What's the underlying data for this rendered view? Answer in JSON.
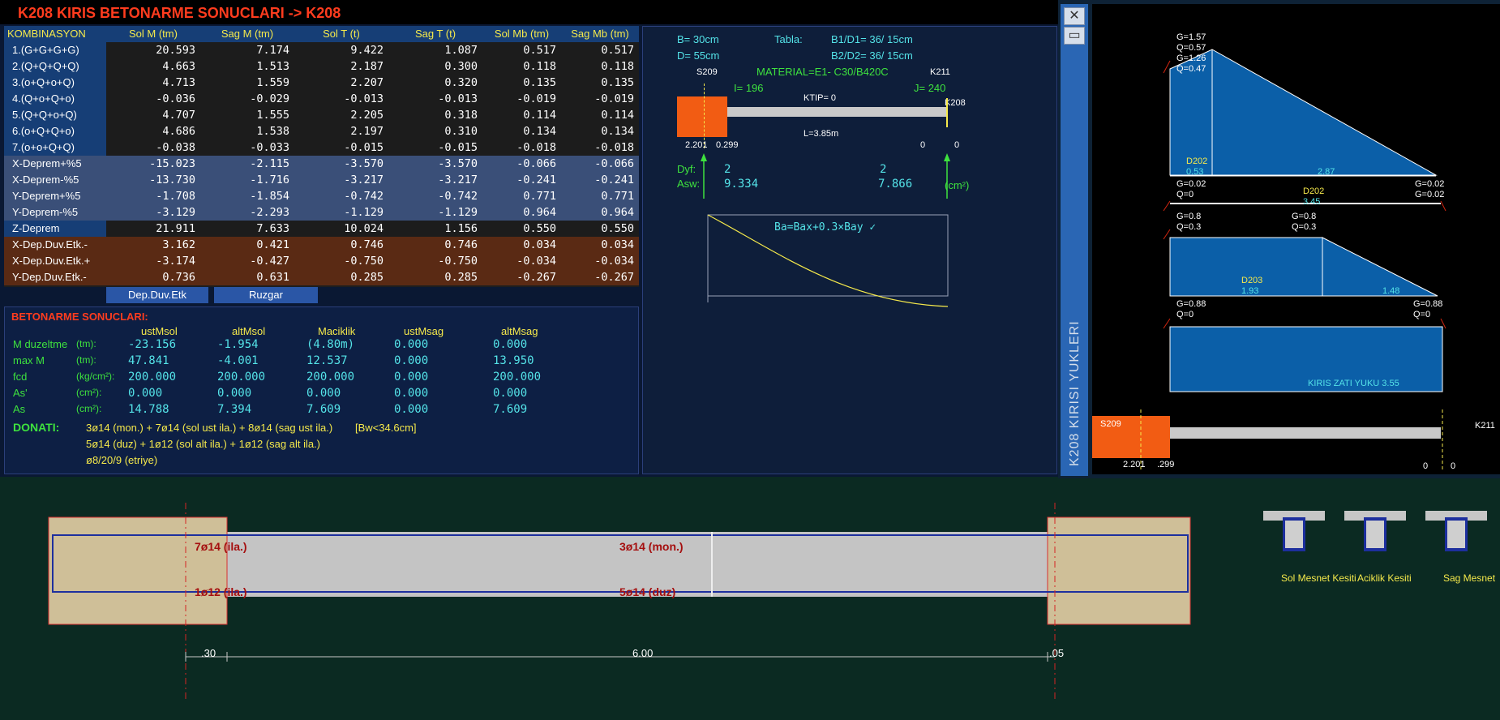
{
  "title": "K208 KIRIS BETONARME SONUCLARI  ->  K208",
  "table": {
    "headers": [
      "KOMBINASYON",
      "Sol M (tm)",
      "Sag M (tm)",
      "Sol T (t)",
      "Sag T (t)",
      "Sol Mb (tm)",
      "Sag Mb (tm)"
    ],
    "rows": [
      {
        "label": "1.(G+G+G+G)",
        "values": [
          "20.593",
          "7.174",
          "9.422",
          "1.087",
          "0.517",
          "0.517"
        ]
      },
      {
        "label": "2.(Q+Q+Q+Q)",
        "values": [
          "4.663",
          "1.513",
          "2.187",
          "0.300",
          "0.118",
          "0.118"
        ]
      },
      {
        "label": "3.(o+Q+o+Q)",
        "values": [
          "4.713",
          "1.559",
          "2.207",
          "0.320",
          "0.135",
          "0.135"
        ]
      },
      {
        "label": "4.(Q+o+Q+o)",
        "values": [
          "-0.036",
          "-0.029",
          "-0.013",
          "-0.013",
          "-0.019",
          "-0.019"
        ]
      },
      {
        "label": "5.(Q+Q+o+Q)",
        "values": [
          "4.707",
          "1.555",
          "2.205",
          "0.318",
          "0.114",
          "0.114"
        ]
      },
      {
        "label": "6.(o+Q+Q+o)",
        "values": [
          "4.686",
          "1.538",
          "2.197",
          "0.310",
          "0.134",
          "0.134"
        ]
      },
      {
        "label": "7.(o+o+Q+Q)",
        "values": [
          "-0.038",
          "-0.033",
          "-0.015",
          "-0.015",
          "-0.018",
          "-0.018"
        ]
      },
      {
        "label": "X-Deprem+%5",
        "values": [
          "-15.023",
          "-2.115",
          "-3.570",
          "-3.570",
          "-0.066",
          "-0.066"
        ]
      },
      {
        "label": "X-Deprem-%5",
        "values": [
          "-13.730",
          "-1.716",
          "-3.217",
          "-3.217",
          "-0.241",
          "-0.241"
        ]
      },
      {
        "label": "Y-Deprem+%5",
        "values": [
          "-1.708",
          "-1.854",
          "-0.742",
          "-0.742",
          "0.771",
          "0.771"
        ]
      },
      {
        "label": "Y-Deprem-%5",
        "values": [
          "-3.129",
          "-2.293",
          "-1.129",
          "-1.129",
          "0.964",
          "0.964"
        ]
      },
      {
        "label": "Z-Deprem",
        "values": [
          "21.911",
          "7.633",
          "10.024",
          "1.156",
          "0.550",
          "0.550"
        ]
      },
      {
        "label": "X-Dep.Duv.Etk.-",
        "values": [
          "3.162",
          "0.421",
          "0.746",
          "0.746",
          "0.034",
          "0.034"
        ]
      },
      {
        "label": "X-Dep.Duv.Etk.+",
        "values": [
          "-3.174",
          "-0.427",
          "-0.750",
          "-0.750",
          "-0.034",
          "-0.034"
        ]
      },
      {
        "label": "Y-Dep.Duv.Etk.-",
        "values": [
          "0.736",
          "0.631",
          "0.285",
          "0.285",
          "-0.267",
          "-0.267"
        ]
      }
    ],
    "tabs": [
      "Dep.Duv.Etk",
      "Ruzgar"
    ]
  },
  "beton": {
    "title": "BETONARME SONUCLARI:",
    "col_headers": [
      "ustMsol",
      "altMsol",
      "Maciklik",
      "ustMsag",
      "altMsag"
    ],
    "rows": [
      {
        "label": "M duzeltme",
        "unit": "(tm):",
        "values": [
          "-23.156",
          "-1.954",
          "(4.80m)",
          "0.000",
          "0.000"
        ]
      },
      {
        "label": "max M",
        "unit": "(tm):",
        "values": [
          "47.841",
          "-4.001",
          "12.537",
          "0.000",
          "13.950"
        ]
      },
      {
        "label": "fcd",
        "unit": "(kg/cm²):",
        "values": [
          "200.000",
          "200.000",
          "200.000",
          "0.000",
          "200.000"
        ]
      },
      {
        "label": "As'",
        "unit": "(cm²):",
        "values": [
          "0.000",
          "0.000",
          "0.000",
          "0.000",
          "0.000"
        ]
      },
      {
        "label": "As",
        "unit": "(cm²):",
        "values": [
          "14.788",
          "7.394",
          "7.609",
          "0.000",
          "7.609"
        ]
      }
    ],
    "donati_label": "DONATI:",
    "donati_lines": [
      "3ø14 (mon.) + 7ø14 (sol ust ila.) + 8ø14 (sag ust ila.)",
      "5ø14 (duz) + 1ø12 (sol alt ila.) + 1ø12 (sag alt ila.)",
      "ø8/20/9 (etriye)"
    ],
    "bw_note": "[Bw<34.6cm]"
  },
  "schematic": {
    "b": "B= 30cm",
    "d": "D= 55cm",
    "tabla": "Tabla:",
    "b1d1": "B1/D1= 36/ 15cm",
    "b2d2": "B2/D2= 36/ 15cm",
    "material": "MATERIAL=E1-  C30/B420C",
    "left_col": "S209",
    "right_col": "K211",
    "i": "I= 196",
    "j": "J= 240",
    "ktip": "KTIP= 0",
    "beam_id": "K208",
    "length": "L=3.85m",
    "left_dims": [
      "2.201",
      "0.299"
    ],
    "right_dims": [
      "0",
      "0"
    ],
    "dyf_label": "Dyf:",
    "asw_label": "Asw:",
    "dyf_left": "2",
    "dyf_right": "2",
    "asw_left": "9.334",
    "asw_right": "7.866",
    "asw_unit": "(cm²)",
    "moment_note": "Ba=Bax+0.3×Bay ✓"
  },
  "loads": {
    "vertical_title": "K208 KIRISI YUKLERI",
    "labels": [
      "G=1.57",
      "Q=0.57",
      "G=1.26",
      "Q=0.47",
      "D202",
      "0.53",
      "2.87",
      "G=0.02",
      "Q=0",
      "G=0.02",
      "D202",
      "3.45",
      "G=0.02",
      "Q=0",
      "G=0.8",
      "Q=0.3",
      "G=0.8",
      "Q=0.3",
      "D203",
      "1.93",
      "1.48",
      "G=0.88",
      "Q=0",
      "G=0.88",
      "Q=0",
      "KIRIS ZATI YUKU  3.55"
    ],
    "left_col": "S209",
    "right_col": "K211",
    "dims": [
      "2.201",
      ".299",
      "0",
      "0"
    ]
  },
  "elevation": {
    "top_left_bar": "7ø14 (ila.)",
    "bottom_left_bar": "1ø12 (ila.)",
    "top_mid_bar": "3ø14 (mon.)",
    "bottom_mid_bar": "5ø14 (duz)",
    "dim_left": ".30",
    "dim_mid": "6.00",
    "dim_right": ".05",
    "sections": [
      "Sol Mesnet Kesiti",
      "Aciklik Kesiti",
      "Sag Mesnet"
    ]
  },
  "colors": {
    "title_red": "#ff3c1e",
    "header_yellow": "#f5e94b",
    "value_cyan": "#54e3e8",
    "column_orange": "#f25c13",
    "load_blue": "#0b5fa8",
    "rebar_red": "#a50f0f"
  }
}
